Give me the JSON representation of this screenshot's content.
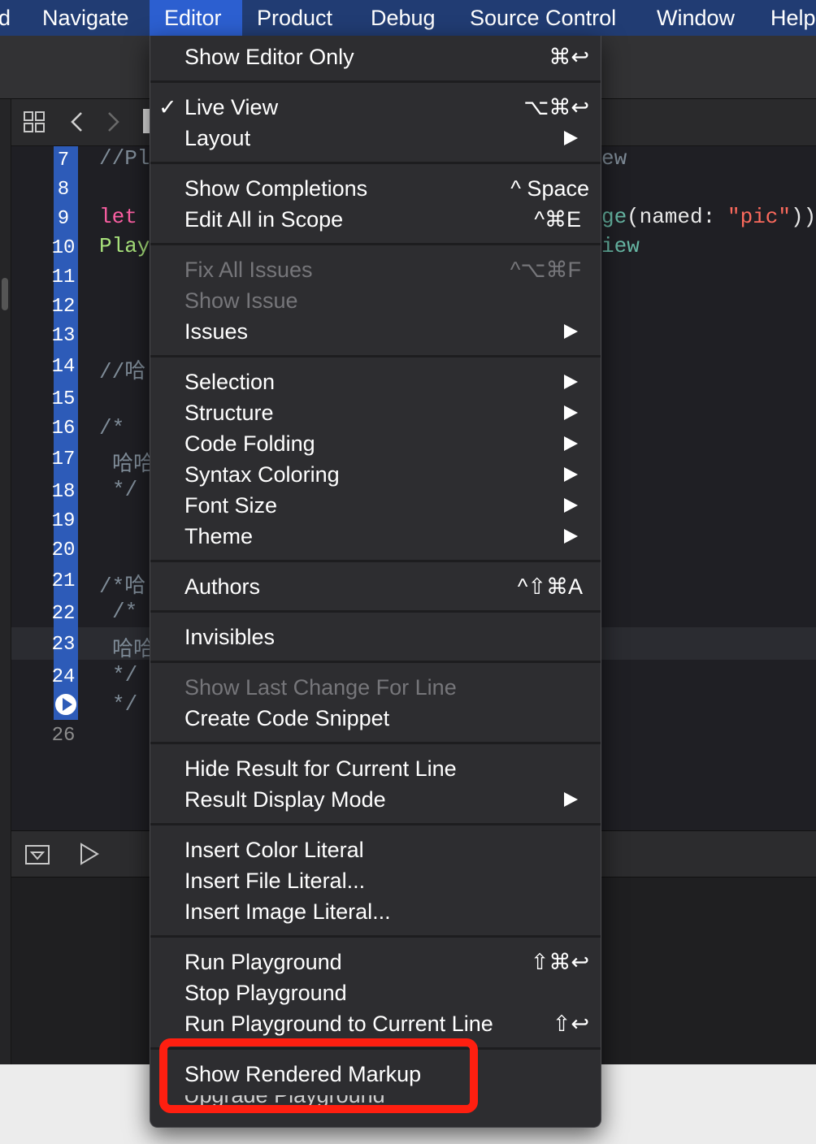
{
  "menubar": {
    "items": [
      "d",
      "Navigate",
      "Editor",
      "Product",
      "Debug",
      "Source Control",
      "Window",
      "Help"
    ],
    "active": "Editor"
  },
  "editor": {
    "line_numbers": [
      "7",
      "8",
      "9",
      "10",
      "11",
      "12",
      "13",
      "14",
      "15",
      "16",
      "17",
      "18",
      "19",
      "20",
      "21",
      "22",
      "23",
      "24",
      "26"
    ],
    "code": {
      "l7": "//Pl",
      "l9_kw": "let",
      "l10": "Play",
      "l14": "//哈",
      "l16": "/*",
      "l17": "哈哈",
      "l18": "*/",
      "l21": "/*哈",
      "l22": "/*",
      "l23": "哈哈",
      "l24": "*/",
      "l25": "*/",
      "r7": "ew",
      "r9_a": "ge",
      "r9_b": "(named: ",
      "r9_c": "\"pic\"",
      "r9_d": "))",
      "r10": "iew"
    }
  },
  "menu": {
    "items": [
      {
        "label": "Show Editor Only",
        "shortcut": "⌘↩"
      },
      {
        "label": "Live View",
        "shortcut": "⌥⌘↩",
        "checked": true
      },
      {
        "label": "Layout"
      },
      {
        "label": "Show Completions",
        "shortcut": "^ Space"
      },
      {
        "label": "Edit All in Scope",
        "shortcut": "^⌘E"
      },
      {
        "label": "Fix All Issues",
        "shortcut": "^⌥⌘F",
        "disabled": true
      },
      {
        "label": "Show Issue",
        "disabled": true
      },
      {
        "label": "Issues"
      },
      {
        "label": "Selection"
      },
      {
        "label": "Structure"
      },
      {
        "label": "Code Folding"
      },
      {
        "label": "Syntax Coloring"
      },
      {
        "label": "Font Size"
      },
      {
        "label": "Theme"
      },
      {
        "label": "Authors",
        "shortcut": "^⇧⌘A"
      },
      {
        "label": "Invisibles"
      },
      {
        "label": "Show Last Change For Line",
        "disabled": true
      },
      {
        "label": "Create Code Snippet"
      },
      {
        "label": "Hide Result for Current Line"
      },
      {
        "label": "Result Display Mode"
      },
      {
        "label": "Insert Color Literal"
      },
      {
        "label": "Insert File Literal..."
      },
      {
        "label": "Insert Image Literal..."
      },
      {
        "label": "Run Playground",
        "shortcut": "⇧⌘↩"
      },
      {
        "label": "Stop Playground"
      },
      {
        "label": "Run Playground to Current Line",
        "shortcut": "⇧↩"
      },
      {
        "label": "Show Rendered Markup"
      }
    ],
    "checkmark": "✓",
    "partially_hidden": "Upgrade Playground"
  },
  "colors": {
    "menubar_bg": "#213c73",
    "menubar_active": "#2c5fd0",
    "menu_bg": "#2d2d30",
    "highlight_box": "#ff1f10"
  }
}
